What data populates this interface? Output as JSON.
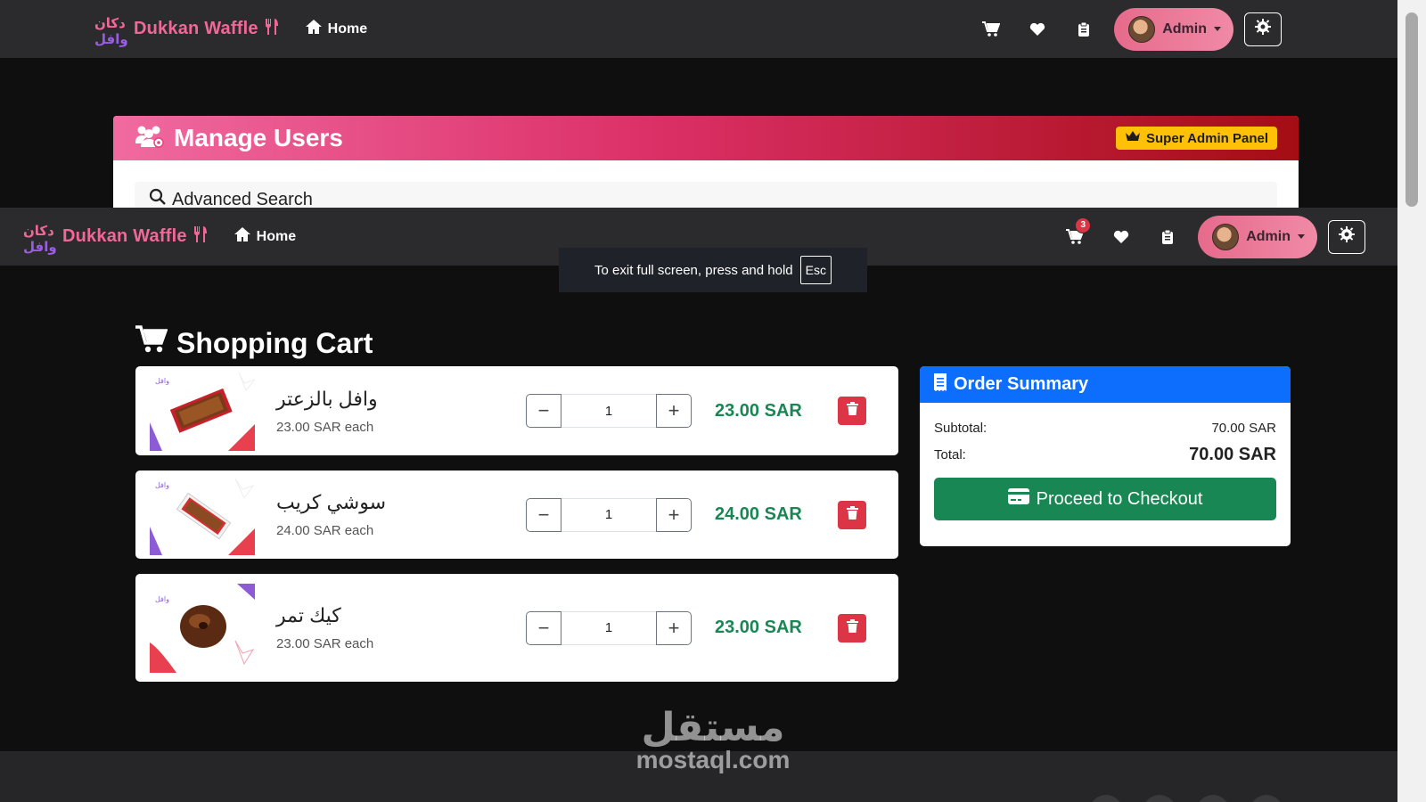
{
  "brand": {
    "name": "Dukkan Waffle",
    "logo_text": "دكان وافل"
  },
  "nav": {
    "home_label": "Home",
    "cart_badge": "3",
    "admin_label": "Admin"
  },
  "manage_users": {
    "title": "Manage Users",
    "badge": "Super Admin Panel",
    "advanced_search": "Advanced Search"
  },
  "fullscreen_notice": {
    "text": "To exit full screen, press and hold",
    "key": "Esc"
  },
  "cart": {
    "title": "Shopping Cart",
    "items": [
      {
        "name": "وافل بالزعتر",
        "each": "23.00 SAR each",
        "qty": "1",
        "total": "23.00 SAR",
        "image": "waffle-box"
      },
      {
        "name": "سوشي كريب",
        "each": "24.00 SAR each",
        "qty": "1",
        "total": "24.00 SAR",
        "image": "crepe-box"
      },
      {
        "name": "كيك تمر",
        "each": "23.00 SAR each",
        "qty": "1",
        "total": "23.00 SAR",
        "image": "date-cake"
      }
    ]
  },
  "summary": {
    "title": "Order Summary",
    "subtotal_label": "Subtotal:",
    "subtotal_value": "70.00 SAR",
    "total_label": "Total:",
    "total_value": "70.00 SAR",
    "checkout_label": "Proceed to Checkout"
  },
  "watermark": {
    "arabic": "مستقل",
    "latin": "mostaql.com"
  },
  "colors": {
    "brand_pink": "#f0689a",
    "success": "#198754",
    "primary": "#0d6efd",
    "danger": "#dc3545",
    "warning": "#ffc107"
  }
}
